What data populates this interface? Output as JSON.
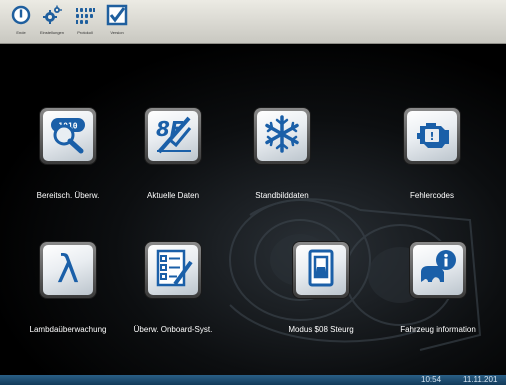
{
  "toolbar": {
    "buttons": [
      {
        "label": "Ende",
        "icon": "power-icon"
      },
      {
        "label": "Einstellungen",
        "icon": "gears-icon"
      },
      {
        "label": "Protokoll",
        "icon": "binary-log-icon"
      },
      {
        "label": "Version",
        "icon": "checkbox-icon"
      }
    ]
  },
  "tiles": [
    {
      "label": "Bereitsch. Überw.",
      "icon": "readiness-monitor-icon"
    },
    {
      "label": "Aktuelle Daten",
      "icon": "live-data-icon"
    },
    {
      "label": "Standbilddaten",
      "icon": "freeze-frame-snowflake-icon"
    },
    {
      "label": "Fehlercodes",
      "icon": "engine-fault-icon"
    },
    {
      "label": "Lambdaüberwachung",
      "icon": "lambda-icon"
    },
    {
      "label": "Überw. Onboard-Syst.",
      "icon": "checklist-icon"
    },
    {
      "label": "Modus $08 Steurg",
      "icon": "switch-icon"
    },
    {
      "label": "Fahrzeug information",
      "icon": "vehicle-info-icon"
    }
  ],
  "status": {
    "time": "10:54",
    "date": "11.11.201"
  },
  "colors": {
    "tile_icon": "#1a5fa8",
    "statusbar": "#1e4d73",
    "toolbar_icon": "#1f5f9e"
  }
}
